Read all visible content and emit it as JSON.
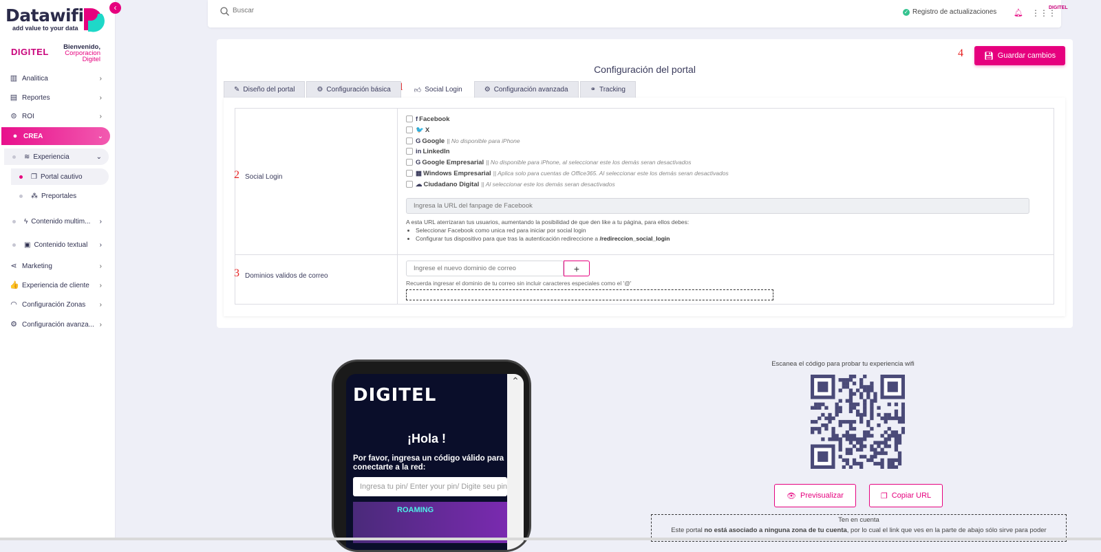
{
  "sidebar": {
    "logo": "Datawifi",
    "logo_trademark": "®",
    "tagline": "add value to your data",
    "collapse_icon": "chevron-left-icon",
    "brand": "DIGITEL",
    "welcome": "Bienvenido,",
    "company": "Corporacion Digitel",
    "items": [
      {
        "label": "Analitica",
        "icon": "bar-chart-icon"
      },
      {
        "label": "Reportes",
        "icon": "document-icon"
      },
      {
        "label": "ROI",
        "icon": "dollar-icon"
      },
      {
        "label": "CREA",
        "icon": "lightbulb-icon"
      },
      {
        "label": "Experiencia",
        "icon": "layers-icon"
      },
      {
        "label": "Portal cautivo",
        "icon": "window-icon"
      },
      {
        "label": "Preportales",
        "icon": "cubes-icon"
      },
      {
        "label": "Contenido multim...",
        "icon": "rss-icon"
      },
      {
        "label": "Contenido textual",
        "icon": "inbox-icon"
      },
      {
        "label": "Marketing",
        "icon": "share-icon"
      },
      {
        "label": "Experiencia de cliente",
        "icon": "thumbs-up-icon"
      },
      {
        "label": "Configuración Zonas",
        "icon": "wifi-icon"
      },
      {
        "label": "Configuración avanza...",
        "icon": "gear-icon"
      }
    ]
  },
  "topbar": {
    "search_placeholder": "Buscar",
    "updates": "Registro de actualizaciones",
    "brand": "DIGITEL"
  },
  "card": {
    "title": "Configuración del portal",
    "save": "Guardar cambios",
    "annotations": [
      "1",
      "2",
      "3",
      "4"
    ],
    "tabs": [
      {
        "label": "Diseño del portal",
        "icon": "brush-icon"
      },
      {
        "label": "Configuración básica",
        "icon": "gear-icon"
      },
      {
        "label": "Social Login",
        "icon": "thumbs-up-icon"
      },
      {
        "label": "Configuración avanzada",
        "icon": "gears-icon"
      },
      {
        "label": "Tracking",
        "icon": "link-icon"
      }
    ]
  },
  "social": {
    "label": "Social Login",
    "options": [
      {
        "icon_glyph": "f",
        "name": "Facebook",
        "note": ""
      },
      {
        "icon_glyph": "🐦",
        "name": "X",
        "note": ""
      },
      {
        "icon_glyph": "G",
        "name": "Google",
        "note": "|| No disponible para iPhone"
      },
      {
        "icon_glyph": "in",
        "name": "LinkedIn",
        "note": ""
      },
      {
        "icon_glyph": "G",
        "name": "Google Empresarial",
        "note": "|| No disponible para iPhone, al seleccionar este los demás seran desactivados"
      },
      {
        "icon_glyph": "▦",
        "name": "Windows Empresarial",
        "note": "|| Aplica solo para cuentas de Office365. Al seleccionar este los demás seran desactivados"
      },
      {
        "icon_glyph": "☁",
        "name": "Ciudadano Digital",
        "note": "|| Al seleccionar este los demás seran desactivados"
      }
    ],
    "fanpage_placeholder": "Ingresa la URL del fanpage de Facebook",
    "help_intro": "A esta URL aterrizaran tus usuarios, aumentando la posibilidad de que den like a tu página, para ellos debes:",
    "help_1": "Seleccionar Facebook como unica red para iniciar por social login",
    "help_2": "Configurar tus dispositivo para que tras la autenticación redireccione a",
    "help_2_path": "/redireccion_social_login"
  },
  "domains": {
    "label": "Dominios validos de correo",
    "placeholder": "Ingrese el nuevo dominio de correo",
    "add": "+",
    "help": "Recuerda ingresar el dominio de tu correo sin incluir caracteres especiales como el '@'"
  },
  "preview": {
    "brand": "DIGITEL",
    "greeting": "¡Hola !",
    "message": "Por favor, ingresa un código válido para conectarte a la red:",
    "pin_placeholder": "Ingresa tu pin/ Enter your pin/ Digite seu pin",
    "banner": "ROAMING"
  },
  "qr": {
    "title": "Escanea el código para probar tu experiencia wifi",
    "preview_btn": "Previsualizar",
    "copy_btn": "Copiar URL",
    "note_title": "Ten en cuenta",
    "note_a": "Este portal",
    "note_bold": "no está asociado a ninguna zona de tu cuenta",
    "note_b": ", por lo cual el link que ves en la parte de abajo sólo sirve para poder"
  }
}
